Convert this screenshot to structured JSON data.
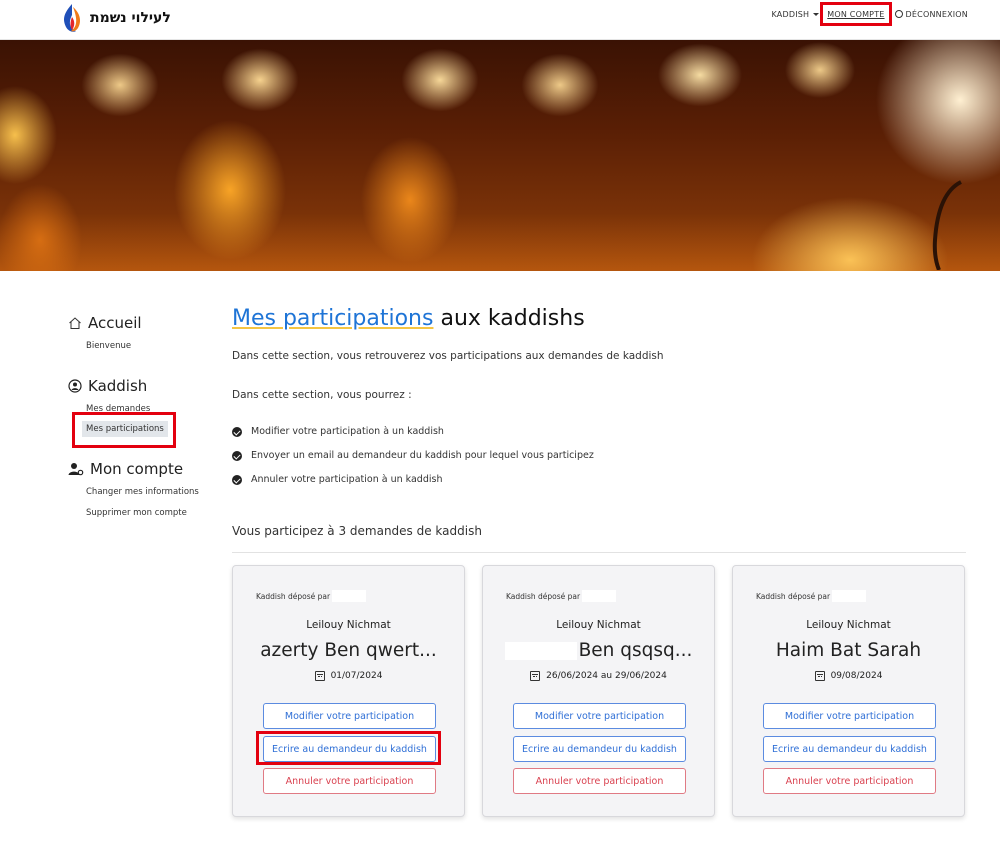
{
  "logo": {
    "text": "לעילוי נשמת",
    "icon": "flame-icon"
  },
  "navbar": {
    "kaddish_label": "KADDISH",
    "account_label": "MON COMPTE",
    "logout_label": "DÉCONNEXION"
  },
  "sidebar": {
    "sections": [
      {
        "title": "Accueil",
        "icon": "home-icon",
        "links": [
          "Bienvenue"
        ]
      },
      {
        "title": "Kaddish",
        "icon": "user-circle-icon",
        "links": [
          "Mes demandes",
          "Mes participations"
        ]
      },
      {
        "title": "Mon compte",
        "icon": "user-gear-icon",
        "links": [
          "Changer mes informations",
          "Supprimer mon compte"
        ]
      }
    ],
    "active": "Mes participations"
  },
  "main": {
    "title_link": "Mes participations",
    "title_rest": "aux kaddishs",
    "intro": "Dans cette section, vous retrouverez vos participations aux demandes de kaddish",
    "can_do": "Dans cette section, vous pourrez :",
    "bullets": [
      "Modifier votre participation à un kaddish",
      "Envoyer un email au demandeur du kaddish pour lequel vous participez",
      "Annuler votre participation à un kaddish"
    ],
    "count_text": "Vous participez à 3 demandes de kaddish"
  },
  "cards": [
    {
      "by_label": "Kaddish déposé par",
      "leilouy": "Leilouy Nichmat",
      "name": "azerty Ben qwert...",
      "date": "01/07/2024"
    },
    {
      "by_label": "Kaddish déposé par",
      "leilouy": "Leilouy Nichmat",
      "name": "Ben qsqsq...",
      "date": "26/06/2024 au 29/06/2024"
    },
    {
      "by_label": "Kaddish déposé par",
      "leilouy": "Leilouy Nichmat",
      "name": "Haim Bat Sarah",
      "date": "09/08/2024"
    }
  ],
  "card_buttons": {
    "modify": "Modifier votre participation",
    "write": "Ecrire au demandeur du kaddish",
    "cancel": "Annuler votre participation"
  },
  "colors": {
    "accent": "#1e74d6",
    "danger": "#d9414f",
    "highlight": "#e3000f"
  }
}
